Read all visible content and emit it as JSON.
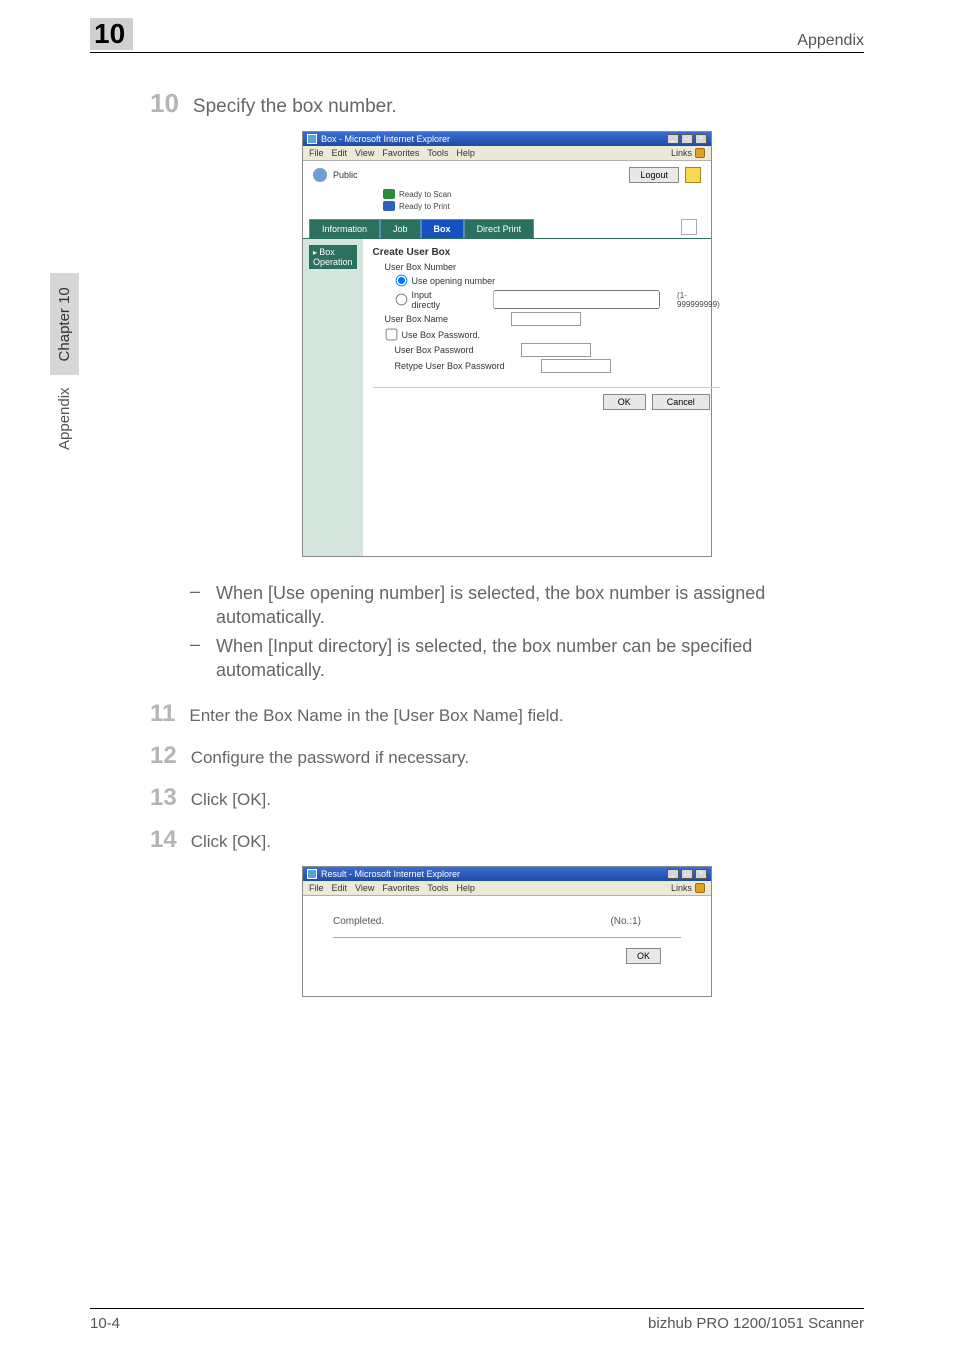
{
  "header": {
    "chapter_number_badge": "10",
    "right_label": "Appendix"
  },
  "side_tab": {
    "section": "Appendix",
    "chapter": "Chapter 10"
  },
  "step10": {
    "number": "10",
    "text": "Specify the box number."
  },
  "dialog1": {
    "titlebar": {
      "title": "Box - Microsoft Internet Explorer",
      "min": "_",
      "max": "□",
      "close": "×"
    },
    "menu": {
      "items": [
        "File",
        "Edit",
        "View",
        "Favorites",
        "Tools",
        "Help"
      ],
      "links_label": "Links"
    },
    "topbar": {
      "user_label": "Public",
      "logout": "Logout"
    },
    "status": {
      "scan": "Ready to Scan",
      "print": "Ready to Print"
    },
    "tabs": {
      "information": "Information",
      "job": "Job",
      "box": "Box",
      "direct_print": "Direct Print"
    },
    "sidebar": {
      "box_operation": "Box Operation"
    },
    "form": {
      "title": "Create User Box",
      "user_box_number_label": "User Box Number",
      "use_opening_number": "Use opening number",
      "input_directly": "Input directly",
      "input_hint": "(1-999999999)",
      "user_box_name_label": "User Box Name",
      "use_box_password": "Use Box Password.",
      "user_box_password_label": "User Box Password",
      "retype_password_label": "Retype User Box Password",
      "ok": "OK",
      "cancel": "Cancel"
    }
  },
  "bullets": {
    "b1": "When [Use opening number] is selected, the box number is assigned automatically.",
    "b2": "When [Input directory] is selected, the box number can be specified automatically."
  },
  "step11": {
    "number": "11",
    "text": "Enter the Box Name in the [User Box Name] field."
  },
  "step12": {
    "number": "12",
    "text": "Configure the password if necessary."
  },
  "step13": {
    "number": "13",
    "text": "Click [OK]."
  },
  "step14": {
    "number": "14",
    "text": "Click [OK]."
  },
  "dialog2": {
    "titlebar": {
      "title": "Result - Microsoft Internet Explorer",
      "min": "_",
      "max": "□",
      "close": "×"
    },
    "menu": {
      "items": [
        "File",
        "Edit",
        "View",
        "Favorites",
        "Tools",
        "Help"
      ],
      "links_label": "Links"
    },
    "body": {
      "completed": "Completed.",
      "number": "(No.:1)",
      "ok": "OK"
    }
  },
  "footer": {
    "left": "10-4",
    "right": "bizhub PRO 1200/1051 Scanner"
  }
}
